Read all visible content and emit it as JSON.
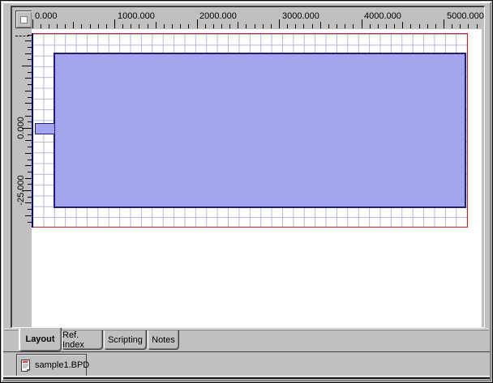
{
  "colors": {
    "chrome": "#c0c0c0",
    "canvas": "#ffffff",
    "grid": "#b6b6da",
    "domain_border": "#cc2222",
    "shape_fill": "#a3a3ee",
    "shape_border": "#202070"
  },
  "hruler": {
    "labels": [
      "0.000",
      "1000.000",
      "2000.000",
      "3000.000",
      "4000.000",
      "5000.000"
    ]
  },
  "vruler": {
    "labels": [
      "0.000",
      "-25.000"
    ]
  },
  "tabs": [
    {
      "label": "Layout",
      "active": true
    },
    {
      "label": "Ref. Index",
      "active": false
    },
    {
      "label": "Scripting",
      "active": false
    },
    {
      "label": "Notes",
      "active": false
    }
  ],
  "file_tab": {
    "label": "sample1.BPD",
    "icon": "doc-icon"
  }
}
